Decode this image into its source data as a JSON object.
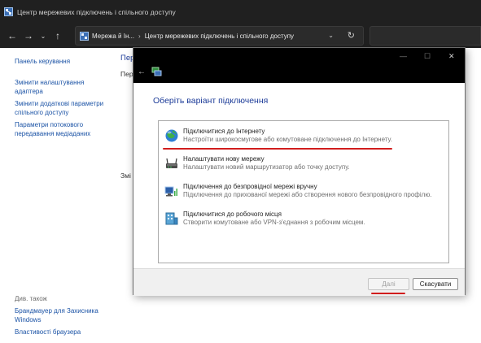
{
  "window": {
    "title": "Центр мережевих підключень і спільного доступу"
  },
  "address": {
    "crumb1": "Мережа й Ін...",
    "separator": "›",
    "crumb2": "Центр мережевих підключень і спільного доступу",
    "search_placeholder": ""
  },
  "nav": {
    "back": "←",
    "forward": "→",
    "history": "⌄",
    "up": "↑",
    "dropdown": "⌄",
    "refresh": "↻"
  },
  "sidebar": {
    "items": [
      {
        "label": "Панель керування"
      },
      {
        "label_line1": "Змінити налаштування",
        "label_line2": "адаптера"
      },
      {
        "label_line1": "Змінити додаткові параметри",
        "label_line2": "спільного доступу"
      },
      {
        "label_line1": "Параметри потокового",
        "label_line2": "передавання медіаданих"
      }
    ],
    "see_also": "Див. також",
    "footer_links": [
      {
        "label_line1": "Брандмауер для Захисника",
        "label_line2": "Windows"
      },
      {
        "label": "Властивості браузера"
      }
    ]
  },
  "background": {
    "frag1": "Пер",
    "frag2": "Пер",
    "frag3": "Змі"
  },
  "dialog": {
    "window_controls": {
      "minimize": "—",
      "maximize": "☐",
      "close": "✕"
    },
    "back": "←",
    "heading": "Оберіть варіант підключення",
    "options": [
      {
        "icon": "internet-globe-icon",
        "title": "Підключитися до Інтернету",
        "desc": "Настроїти широкосмугове або комутоване підключення до Інтернету."
      },
      {
        "icon": "router-icon",
        "title": "Налаштувати нову мережу",
        "desc": "Налаштувати новий маршрутизатор або точку доступу."
      },
      {
        "icon": "wireless-network-icon",
        "title": "Підключення до безпровідної мережі вручну",
        "desc": "Підключення до прихованої мережі або створення нового безпровідного профілю."
      },
      {
        "icon": "workplace-icon",
        "title": "Підключитися до робочого місця",
        "desc": "Створити комутоване або VPN-з'єднання з робочим місцем."
      }
    ],
    "next_label": "Далі",
    "cancel_label": "Скасувати"
  },
  "colors": {
    "titlebar_bg": "#202020",
    "link": "#1a52a5",
    "heading": "#1d3c99",
    "annotation_red": "#d11d1d"
  }
}
